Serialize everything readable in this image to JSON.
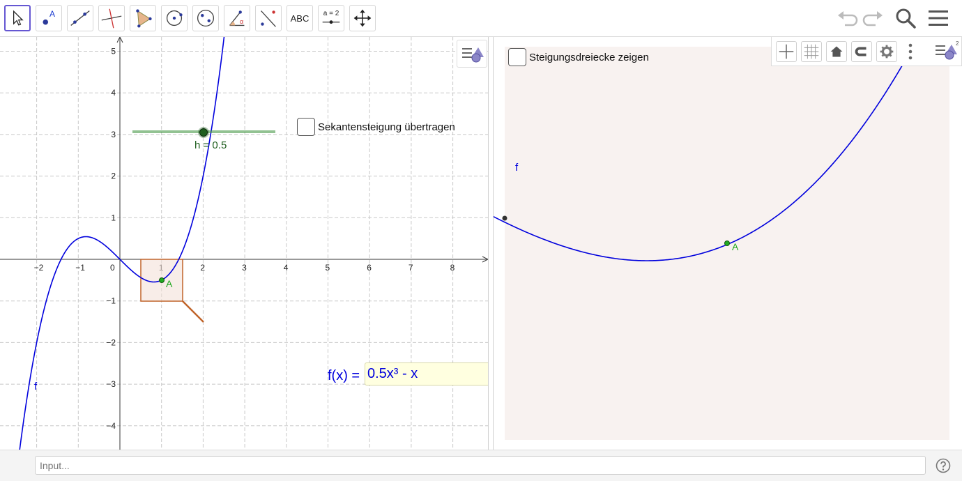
{
  "toolbar": {
    "tools": [
      {
        "name": "move-tool",
        "icon": "arrow-pointer-icon",
        "label": ""
      },
      {
        "name": "point-tool",
        "icon": "point-icon",
        "label": "A"
      },
      {
        "name": "line-tool",
        "icon": "line-icon",
        "label": ""
      },
      {
        "name": "perpendicular-tool",
        "icon": "perpendicular-line-icon",
        "label": ""
      },
      {
        "name": "polygon-tool",
        "icon": "polygon-icon",
        "label": ""
      },
      {
        "name": "circle-tool",
        "icon": "circle-icon",
        "label": ""
      },
      {
        "name": "ellipse-tool",
        "icon": "ellipse-icon",
        "label": ""
      },
      {
        "name": "angle-tool",
        "icon": "angle-icon",
        "label": "α"
      },
      {
        "name": "reflect-tool",
        "icon": "reflect-icon",
        "label": ""
      },
      {
        "name": "text-tool",
        "icon": "text-icon",
        "label": "ABC"
      },
      {
        "name": "slider-tool",
        "icon": "slider-icon",
        "label": "a = 2"
      },
      {
        "name": "move-graphics-tool",
        "icon": "move-arrows-icon",
        "label": ""
      }
    ]
  },
  "graphics1": {
    "x_ticks": [
      "−2",
      "−1",
      "0",
      "1",
      "2",
      "3",
      "4",
      "5",
      "6",
      "7",
      "8"
    ],
    "y_ticks": [
      "5",
      "4",
      "3",
      "2",
      "1",
      "−1",
      "−2",
      "−3",
      "−4"
    ],
    "function_label": "f",
    "point_label": "A",
    "slider": {
      "label": "h = 0.5",
      "value": 0.5
    },
    "checkbox": {
      "label": "Sekantensteigung übertragen",
      "checked": false
    },
    "input_label": "f(x) =",
    "input_value": "0.5x³ - x"
  },
  "graphics2": {
    "checkbox": {
      "label": "Steigungsdreiecke zeigen",
      "checked": false
    },
    "function_label": "f",
    "point_label": "A"
  },
  "inputbar": {
    "placeholder": "Input..."
  },
  "colors": {
    "curve": "#0000dd",
    "point": "#22aa22",
    "slider": "#1e5e1e",
    "triangle": "#c0642a",
    "view2_bg": "#f8f2f0"
  }
}
